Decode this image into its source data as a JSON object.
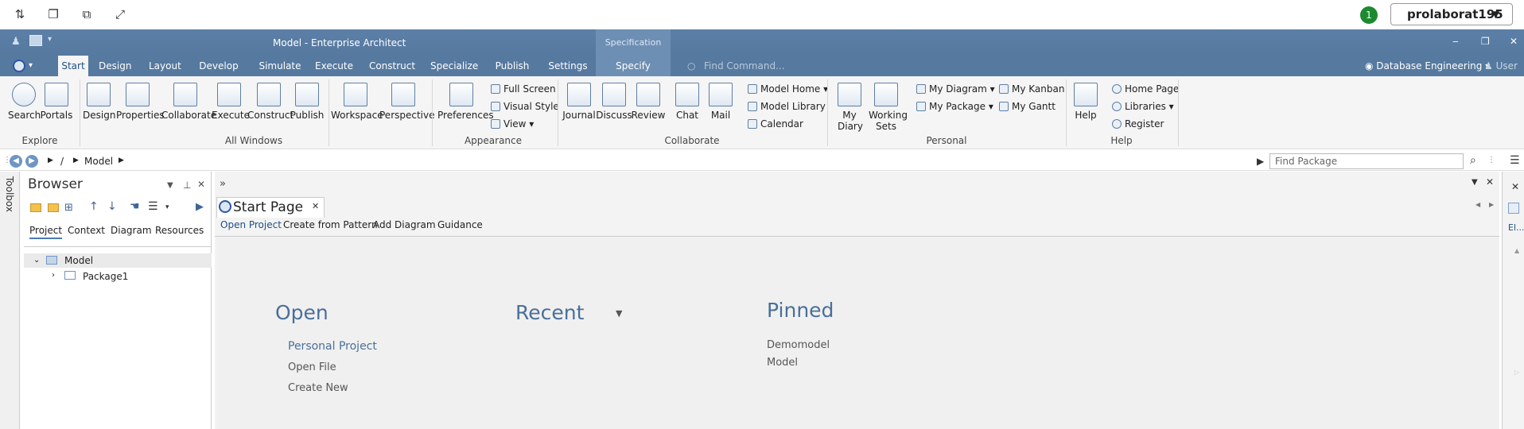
{
  "topbar": {
    "notification_count": "1",
    "user_name": "prolaborat195"
  },
  "window": {
    "title": "Model - Enterprise Architect",
    "spec_context": "Specification"
  },
  "ribbon": {
    "tabs": [
      "Start",
      "Design",
      "Layout",
      "Develop",
      "Simulate",
      "Execute",
      "Construct",
      "Specialize",
      "Publish",
      "Settings"
    ],
    "active_tab": "Start",
    "specify_tab": "Specify",
    "find_command": "Find Command...",
    "workspace": "Database Engineering",
    "user": "User",
    "buttons": {
      "search": "Search",
      "portals": "Portals",
      "design": "Design",
      "properties": "Properties",
      "collaborate": "Collaborate",
      "execute": "Execute",
      "construct": "Construct",
      "publish": "Publish",
      "workspace": "Workspace",
      "perspective": "Perspective",
      "preferences": "Preferences",
      "full_screen": "Full Screen",
      "visual_style": "Visual Style",
      "view": "View",
      "journal": "Journal",
      "discuss": "Discuss",
      "review": "Review",
      "chat": "Chat",
      "mail": "Mail",
      "model_home": "Model Home",
      "model_library": "Model Library",
      "calendar": "Calendar",
      "my_diary": "My Diary",
      "working_sets": "Working Sets",
      "my_diagram": "My Diagram",
      "my_package": "My Package",
      "my_kanban": "My Kanban",
      "my_gantt": "My Gantt",
      "help": "Help",
      "home_page": "Home Page",
      "libraries": "Libraries",
      "register": "Register"
    },
    "groups": {
      "explore": "Explore",
      "all_windows": "All Windows",
      "appearance": "Appearance",
      "collaborate": "Collaborate",
      "personal": "Personal",
      "help": "Help"
    }
  },
  "breadcrumb": {
    "sep": "/",
    "item": "Model",
    "find_package": "Find Package"
  },
  "toolbox": {
    "label": "Toolbox"
  },
  "browser": {
    "title": "Browser",
    "tabs": [
      "Project",
      "Context",
      "Diagram",
      "Resources"
    ],
    "tree": {
      "root": "Model",
      "child": "Package1"
    }
  },
  "main": {
    "doc_tab": "Start Page",
    "subtabs": [
      "Open Project",
      "Create from Pattern",
      "Add Diagram",
      "Guidance"
    ],
    "open": {
      "heading": "Open",
      "links": [
        "Personal Project",
        "Open File",
        "Create New"
      ]
    },
    "recent": {
      "heading": "Recent"
    },
    "pinned": {
      "heading": "Pinned",
      "items": [
        "Demomodel",
        "Model"
      ]
    }
  },
  "right_panel": {
    "label": "El..."
  },
  "colors": {
    "ribbon_blue": "#56799f",
    "accent": "#4a6f9a",
    "badge_green": "#1d8a2f"
  }
}
